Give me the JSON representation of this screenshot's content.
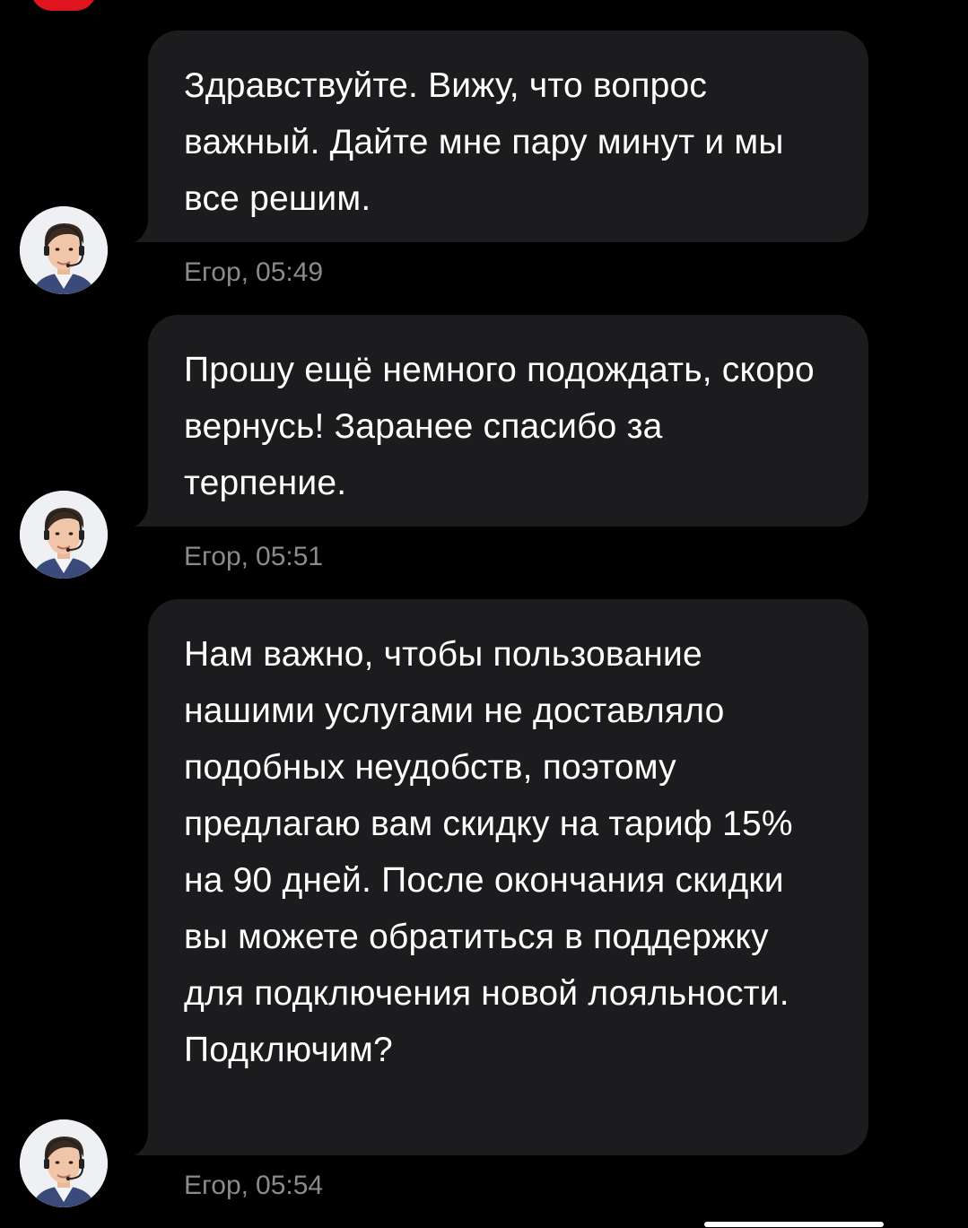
{
  "chat": {
    "messages": [
      {
        "text": "Здравствуйте. Вижу, что вопрос важный. Дайте мне пару минут и мы все решим.",
        "author": "Егор",
        "time": "05:49"
      },
      {
        "text": "Прошу ещё немного подождать, скоро вернусь! Заранее спасибо за терпение.",
        "author": "Егор",
        "time": "05:51"
      },
      {
        "text": "Нам важно, чтобы пользование нашими услугами не доставляло подобных неудобств, поэтому предлагаю вам скидку на тариф 15% на 90 дней. После окончания скидки вы можете обратиться в поддержку для подключения новой лояльности. Подключим?",
        "author": "Егор",
        "time": "05:54"
      }
    ]
  },
  "colors": {
    "background": "#000000",
    "bubble": "#1c1c1e",
    "message_text": "#ffffff",
    "meta_text": "#8a8a8f",
    "top_avatar": "#e0141e"
  },
  "icons": {
    "agent_avatar": "operator-with-headset-avatar"
  }
}
